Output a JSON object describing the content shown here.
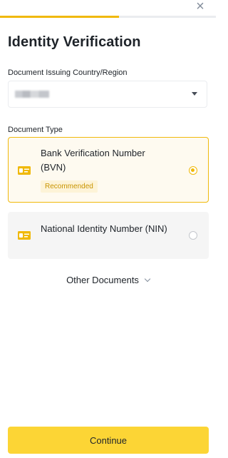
{
  "progress": {
    "fraction": 0.55,
    "color": "#f0b90b"
  },
  "header": {
    "close_symbol": "×",
    "title": "Identity Verification"
  },
  "country": {
    "label": "Document Issuing Country/Region",
    "value_redacted": true,
    "dropdown_icon": "caret-down-icon"
  },
  "document_type": {
    "label": "Document Type",
    "options": [
      {
        "title": "Bank Verification Number (BVN)",
        "badge": "Recommended",
        "selected": true,
        "icon": "id-card-icon"
      },
      {
        "title": "National Identity Number (NIN)",
        "selected": false,
        "icon": "id-card-icon"
      }
    ]
  },
  "other_documents": {
    "label": "Other Documents",
    "icon": "chevron-down-icon"
  },
  "footer": {
    "continue_label": "Continue"
  },
  "colors": {
    "accent": "#f0b90b",
    "button": "#fcd535",
    "badge_bg": "#fdf3d7",
    "badge_text": "#c99400"
  }
}
